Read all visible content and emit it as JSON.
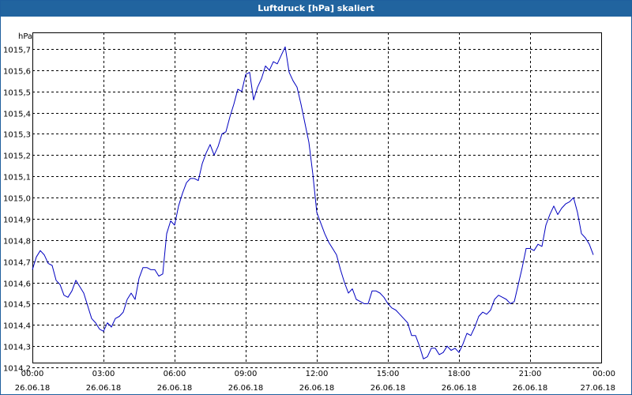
{
  "window": {
    "title": "Luftdruck [hPa] skaliert"
  },
  "chart_data": {
    "type": "line",
    "title": "Luftdruck [hPa] skaliert",
    "ylabel": "hPa",
    "ylim": [
      1014.2,
      1015.7
    ],
    "yticks": [
      1014.2,
      1014.3,
      1014.4,
      1014.5,
      1014.6,
      1014.7,
      1014.8,
      1014.9,
      1015.0,
      1015.1,
      1015.2,
      1015.3,
      1015.4,
      1015.5,
      1015.6,
      1015.7
    ],
    "ytick_labels": [
      "1014,2",
      "1014,3",
      "1014,4",
      "1014,5",
      "1014,6",
      "1014,7",
      "1014,8",
      "1014,9",
      "1015,0",
      "1015,1",
      "1015,2",
      "1015,3",
      "1015,4",
      "1015,5",
      "1015,6",
      "1015,7"
    ],
    "xlim": [
      "26.06.18 00:00",
      "27.06.18 00:00"
    ],
    "xticks": [
      {
        "time": "00:00",
        "date": "26.06.18"
      },
      {
        "time": "03:00",
        "date": "26.06.18"
      },
      {
        "time": "06:00",
        "date": "26.06.18"
      },
      {
        "time": "09:00",
        "date": "26.06.18"
      },
      {
        "time": "12:00",
        "date": "26.06.18"
      },
      {
        "time": "15:00",
        "date": "26.06.18"
      },
      {
        "time": "18:00",
        "date": "26.06.18"
      },
      {
        "time": "21:00",
        "date": "26.06.18"
      },
      {
        "time": "00:00",
        "date": "27.06.18"
      }
    ],
    "grid": true,
    "line_color": "#0000c0",
    "series": [
      {
        "points": [
          [
            "26.06.18 00:00",
            1014.66
          ],
          [
            "26.06.18 00:10",
            1014.72
          ],
          [
            "26.06.18 00:20",
            1014.75
          ],
          [
            "26.06.18 00:30",
            1014.73
          ],
          [
            "26.06.18 00:40",
            1014.69
          ],
          [
            "26.06.18 00:50",
            1014.68
          ],
          [
            "26.06.18 01:00",
            1014.61
          ],
          [
            "26.06.18 01:10",
            1014.59
          ],
          [
            "26.06.18 01:20",
            1014.54
          ],
          [
            "26.06.18 01:30",
            1014.53
          ],
          [
            "26.06.18 01:40",
            1014.56
          ],
          [
            "26.06.18 01:50",
            1014.61
          ],
          [
            "26.06.18 02:00",
            1014.58
          ],
          [
            "26.06.18 02:10",
            1014.55
          ],
          [
            "26.06.18 02:20",
            1014.49
          ],
          [
            "26.06.18 02:30",
            1014.43
          ],
          [
            "26.06.18 02:40",
            1014.41
          ],
          [
            "26.06.18 02:50",
            1014.38
          ],
          [
            "26.06.18 03:00",
            1014.37
          ],
          [
            "26.06.18 03:10",
            1014.41
          ],
          [
            "26.06.18 03:20",
            1014.39
          ],
          [
            "26.06.18 03:30",
            1014.43
          ],
          [
            "26.06.18 03:40",
            1014.44
          ],
          [
            "26.06.18 03:50",
            1014.46
          ],
          [
            "26.06.18 04:00",
            1014.52
          ],
          [
            "26.06.18 04:10",
            1014.55
          ],
          [
            "26.06.18 04:20",
            1014.52
          ],
          [
            "26.06.18 04:30",
            1014.62
          ],
          [
            "26.06.18 04:40",
            1014.67
          ],
          [
            "26.06.18 04:50",
            1014.67
          ],
          [
            "26.06.18 05:00",
            1014.66
          ],
          [
            "26.06.18 05:10",
            1014.66
          ],
          [
            "26.06.18 05:20",
            1014.63
          ],
          [
            "26.06.18 05:30",
            1014.64
          ],
          [
            "26.06.18 05:40",
            1014.83
          ],
          [
            "26.06.18 05:50",
            1014.89
          ],
          [
            "26.06.18 06:00",
            1014.87
          ],
          [
            "26.06.18 06:10",
            1014.96
          ],
          [
            "26.06.18 06:20",
            1015.02
          ],
          [
            "26.06.18 06:30",
            1015.07
          ],
          [
            "26.06.18 06:40",
            1015.09
          ],
          [
            "26.06.18 06:50",
            1015.09
          ],
          [
            "26.06.18 07:00",
            1015.08
          ],
          [
            "26.06.18 07:10",
            1015.16
          ],
          [
            "26.06.18 07:20",
            1015.21
          ],
          [
            "26.06.18 07:30",
            1015.25
          ],
          [
            "26.06.18 07:40",
            1015.2
          ],
          [
            "26.06.18 07:50",
            1015.24
          ],
          [
            "26.06.18 08:00",
            1015.3
          ],
          [
            "26.06.18 08:10",
            1015.31
          ],
          [
            "26.06.18 08:20",
            1015.38
          ],
          [
            "26.06.18 08:30",
            1015.44
          ],
          [
            "26.06.18 08:40",
            1015.51
          ],
          [
            "26.06.18 08:50",
            1015.5
          ],
          [
            "26.06.18 09:00",
            1015.58
          ],
          [
            "26.06.18 09:10",
            1015.59
          ],
          [
            "26.06.18 09:20",
            1015.46
          ],
          [
            "26.06.18 09:30",
            1015.52
          ],
          [
            "26.06.18 09:40",
            1015.56
          ],
          [
            "26.06.18 09:50",
            1015.62
          ],
          [
            "26.06.18 10:00",
            1015.6
          ],
          [
            "26.06.18 10:10",
            1015.64
          ],
          [
            "26.06.18 10:20",
            1015.63
          ],
          [
            "26.06.18 10:30",
            1015.67
          ],
          [
            "26.06.18 10:40",
            1015.71
          ],
          [
            "26.06.18 10:50",
            1015.59
          ],
          [
            "26.06.18 11:00",
            1015.55
          ],
          [
            "26.06.18 11:10",
            1015.52
          ],
          [
            "26.06.18 11:20",
            1015.44
          ],
          [
            "26.06.18 11:30",
            1015.35
          ],
          [
            "26.06.18 11:40",
            1015.26
          ],
          [
            "26.06.18 11:50",
            1015.11
          ],
          [
            "26.06.18 12:00",
            1014.93
          ],
          [
            "26.06.18 12:10",
            1014.88
          ],
          [
            "26.06.18 12:20",
            1014.83
          ],
          [
            "26.06.18 12:30",
            1014.79
          ],
          [
            "26.06.18 12:40",
            1014.76
          ],
          [
            "26.06.18 12:50",
            1014.73
          ],
          [
            "26.06.18 13:00",
            1014.66
          ],
          [
            "26.06.18 13:10",
            1014.6
          ],
          [
            "26.06.18 13:20",
            1014.55
          ],
          [
            "26.06.18 13:30",
            1014.57
          ],
          [
            "26.06.18 13:40",
            1014.52
          ],
          [
            "26.06.18 13:50",
            1014.51
          ],
          [
            "26.06.18 14:00",
            1014.5
          ],
          [
            "26.06.18 14:10",
            1014.5
          ],
          [
            "26.06.18 14:20",
            1014.56
          ],
          [
            "26.06.18 14:30",
            1014.56
          ],
          [
            "26.06.18 14:40",
            1014.55
          ],
          [
            "26.06.18 14:50",
            1014.53
          ],
          [
            "26.06.18 15:00",
            1014.5
          ],
          [
            "26.06.18 15:10",
            1014.48
          ],
          [
            "26.06.18 15:20",
            1014.47
          ],
          [
            "26.06.18 15:30",
            1014.45
          ],
          [
            "26.06.18 15:40",
            1014.43
          ],
          [
            "26.06.18 15:50",
            1014.41
          ],
          [
            "26.06.18 16:00",
            1014.35
          ],
          [
            "26.06.18 16:10",
            1014.35
          ],
          [
            "26.06.18 16:20",
            1014.3
          ],
          [
            "26.06.18 16:30",
            1014.24
          ],
          [
            "26.06.18 16:40",
            1014.25
          ],
          [
            "26.06.18 16:50",
            1014.29
          ],
          [
            "26.06.18 17:00",
            1014.29
          ],
          [
            "26.06.18 17:10",
            1014.26
          ],
          [
            "26.06.18 17:20",
            1014.27
          ],
          [
            "26.06.18 17:30",
            1014.3
          ],
          [
            "26.06.18 17:40",
            1014.28
          ],
          [
            "26.06.18 17:50",
            1014.29
          ],
          [
            "26.06.18 18:00",
            1014.27
          ],
          [
            "26.06.18 18:10",
            1014.31
          ],
          [
            "26.06.18 18:20",
            1014.36
          ],
          [
            "26.06.18 18:30",
            1014.35
          ],
          [
            "26.06.18 18:40",
            1014.39
          ],
          [
            "26.06.18 18:50",
            1014.44
          ],
          [
            "26.06.18 19:00",
            1014.46
          ],
          [
            "26.06.18 19:10",
            1014.45
          ],
          [
            "26.06.18 19:20",
            1014.47
          ],
          [
            "26.06.18 19:30",
            1014.52
          ],
          [
            "26.06.18 19:40",
            1014.54
          ],
          [
            "26.06.18 19:50",
            1014.53
          ],
          [
            "26.06.18 20:00",
            1014.52
          ],
          [
            "26.06.18 20:10",
            1014.5
          ],
          [
            "26.06.18 20:20",
            1014.51
          ],
          [
            "26.06.18 20:30",
            1014.59
          ],
          [
            "26.06.18 20:40",
            1014.67
          ],
          [
            "26.06.18 20:50",
            1014.76
          ],
          [
            "26.06.18 21:00",
            1014.76
          ],
          [
            "26.06.18 21:10",
            1014.75
          ],
          [
            "26.06.18 21:20",
            1014.78
          ],
          [
            "26.06.18 21:30",
            1014.77
          ],
          [
            "26.06.18 21:40",
            1014.87
          ],
          [
            "26.06.18 21:50",
            1014.92
          ],
          [
            "26.06.18 22:00",
            1014.96
          ],
          [
            "26.06.18 22:10",
            1014.92
          ],
          [
            "26.06.18 22:20",
            1014.95
          ],
          [
            "26.06.18 22:30",
            1014.97
          ],
          [
            "26.06.18 22:40",
            1014.98
          ],
          [
            "26.06.18 22:50",
            1015.0
          ],
          [
            "26.06.18 23:00",
            1014.93
          ],
          [
            "26.06.18 23:10",
            1014.83
          ],
          [
            "26.06.18 23:20",
            1014.81
          ],
          [
            "26.06.18 23:30",
            1014.78
          ],
          [
            "26.06.18 23:40",
            1014.73
          ]
        ]
      }
    ]
  }
}
